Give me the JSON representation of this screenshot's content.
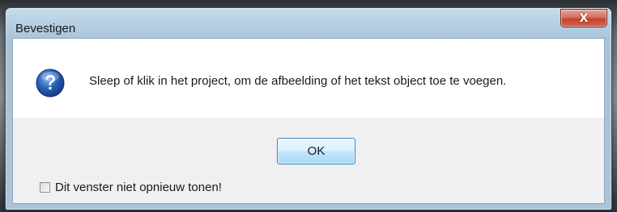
{
  "dialog": {
    "title": "Bevestigen",
    "close_glyph": "X",
    "icon": "question-icon",
    "message": "Sleep of klik in het project, om de afbeelding of het tekst object toe te voegen.",
    "ok_label": "OK",
    "checkbox_label": "Dit venster niet opnieuw tonen!",
    "checkbox_checked": false
  },
  "colors": {
    "icon_blue": "#2a5fb8",
    "close_red": "#c4432f",
    "ok_border": "#3c7fb1"
  }
}
